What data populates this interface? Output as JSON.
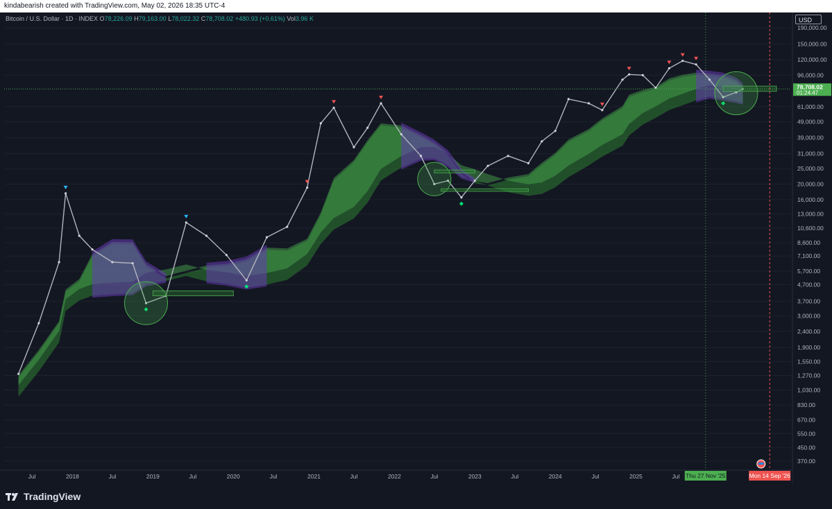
{
  "topbar": {
    "text": "kindabearish created with TradingView.com, May 02, 2026 18:35 UTC-4"
  },
  "legend": {
    "symbol": "Bitcoin / U.S. Dollar · 1D · INDEX",
    "o_label": "O",
    "o": "78,226.09",
    "h_label": "H",
    "h": "79,163.00",
    "l_label": "L",
    "l": "78,022.32",
    "c_label": "C",
    "c": "78,708.02",
    "change": "+480.93 (+0.61%)",
    "vol_label": "Vol",
    "vol": "3.96 K"
  },
  "currency_button": "USD",
  "price_tag": {
    "price": "78,708.02",
    "countdown": "01:24:47"
  },
  "yaxis": {
    "labels": [
      "190,000.00",
      "150,000.00",
      "120,000.00",
      "96,000.00",
      "61,000.00",
      "49,000.00",
      "39,000.00",
      "31,000.00",
      "25,000.00",
      "20,000.00",
      "16,000.00",
      "13,000.00",
      "10,600.00",
      "8,600.00",
      "7,100.00",
      "5,700.00",
      "4,700.00",
      "3,700.00",
      "3,000.00",
      "2,400.00",
      "1,900.00",
      "1,550.00",
      "1,270.00",
      "1,030.00",
      "830.00",
      "670.00",
      "550.00",
      "450.00",
      "370.00"
    ],
    "scale": "log"
  },
  "xaxis": {
    "labels": [
      "Jul",
      "2018",
      "Jul",
      "2019",
      "Jul",
      "2020",
      "Jul",
      "2021",
      "Jul",
      "2022",
      "Jul",
      "2023",
      "Jul",
      "2024",
      "Jul",
      "2025",
      "Jul"
    ],
    "cursor_green": "Thu 27 Nov '25",
    "cursor_red": "Mon 14 Sep '26"
  },
  "footer": {
    "brand": "TradingView"
  },
  "colors": {
    "background": "#131722",
    "grid": "#1e222d",
    "green_band": "#2e7d32",
    "bright_green": "#4caf50",
    "purple_band": "#673ab7",
    "sell_marker": "#ef5350",
    "buy_marker": "#00e676",
    "blue_marker": "#29b6f6"
  },
  "chart_data": {
    "type": "line",
    "title": "",
    "xlabel": "",
    "ylabel": "",
    "x": [
      "2017-05",
      "2017-08",
      "2017-11",
      "2017-12",
      "2018-02",
      "2018-04",
      "2018-07",
      "2018-10",
      "2018-12",
      "2019-03",
      "2019-06",
      "2019-09",
      "2019-12",
      "2020-03",
      "2020-06",
      "2020-09",
      "2020-12",
      "2021-02",
      "2021-04",
      "2021-07",
      "2021-09",
      "2021-11",
      "2022-02",
      "2022-05",
      "2022-07",
      "2022-09",
      "2022-11",
      "2023-01",
      "2023-03",
      "2023-06",
      "2023-09",
      "2023-11",
      "2024-01",
      "2024-03",
      "2024-06",
      "2024-08",
      "2024-11",
      "2024-12",
      "2025-02",
      "2025-04",
      "2025-06",
      "2025-08",
      "2025-10",
      "2025-12",
      "2026-02",
      "2026-04",
      "2026-05"
    ],
    "series": [
      {
        "values": [
          1300,
          2700,
          6500,
          17500,
          9500,
          7800,
          6500,
          6400,
          3600,
          4000,
          11500,
          9500,
          7200,
          5000,
          9300,
          10800,
          19000,
          48000,
          60000,
          34000,
          45000,
          64000,
          41000,
          30000,
          20000,
          21000,
          16500,
          21000,
          26000,
          30000,
          27000,
          37000,
          43000,
          68000,
          64000,
          58000,
          90000,
          97000,
          96000,
          80000,
          106000,
          118000,
          112000,
          90000,
          70000,
          75000,
          78708
        ]
      }
    ],
    "ylim": [
      370,
      190000
    ]
  }
}
